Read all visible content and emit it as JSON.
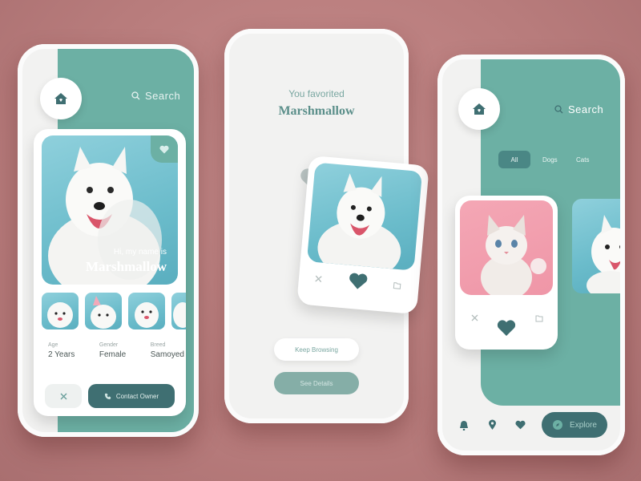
{
  "screen1": {
    "search_label": "Search",
    "intro": "Hi, my name is",
    "pet_name": "Marshmallow",
    "details": [
      {
        "label": "Age",
        "value": "2 Years"
      },
      {
        "label": "Gender",
        "value": "Female"
      },
      {
        "label": "Breed",
        "value": "Samoyed"
      }
    ],
    "contact_label": "Contact Owner"
  },
  "screen2": {
    "favorited_text": "You favorited",
    "pet_name": "Marshmallow",
    "keep_browsing_label": "Keep Browsing",
    "see_details_label": "See Details"
  },
  "screen3": {
    "search_label": "Search",
    "tabs": [
      {
        "label": "All",
        "active": true
      },
      {
        "label": "Dogs",
        "active": false
      },
      {
        "label": "Cats",
        "active": false
      }
    ],
    "explore_label": "Explore"
  },
  "colors": {
    "background": "#b87c7c",
    "teal": "#6cb0a4",
    "dark_teal": "#3f6f72",
    "phone": "#f2f2f1"
  },
  "icons": [
    "home-icon",
    "search-icon",
    "heart-icon",
    "close-icon",
    "phone-icon",
    "bell-icon",
    "location-pin-icon",
    "compass-icon",
    "folder-icon"
  ]
}
